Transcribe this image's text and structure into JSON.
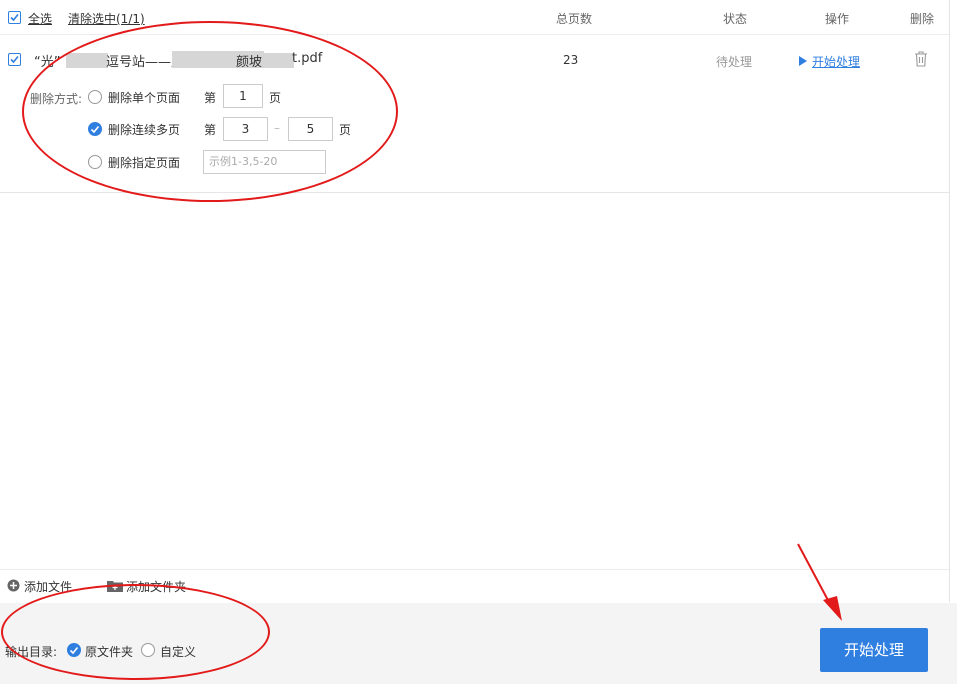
{
  "header": {
    "select_all": "全选",
    "clear_selected": "清除选中(1/1)",
    "col_total_pages": "总页数",
    "col_status": "状态",
    "col_action": "操作",
    "col_delete": "删除"
  },
  "file": {
    "name_prefix": "“光”",
    "name_part2": "逗号站——用",
    "name_part3": "颜坡",
    "name_suffix": "t.pdf",
    "total_pages": "23",
    "status": "待处理",
    "action": "开始处理"
  },
  "delete_options": {
    "label": "删除方式:",
    "single": "删除单个页面",
    "range": "删除连续多页",
    "specific": "删除指定页面",
    "page_prefix": "第",
    "page_suffix": "页",
    "single_value": "1",
    "range_from": "3",
    "range_to": "5",
    "range_sep": "–",
    "specific_placeholder": "示例1-3,5-20"
  },
  "bottom": {
    "add_file": "添加文件",
    "add_folder": "添加文件夹"
  },
  "output": {
    "label": "输出目录:",
    "original_folder": "原文件夹",
    "custom": "自定义"
  },
  "start_button": "开始处理",
  "colors": {
    "accent": "#2f7fe0",
    "annotation": "#e21a1a"
  }
}
